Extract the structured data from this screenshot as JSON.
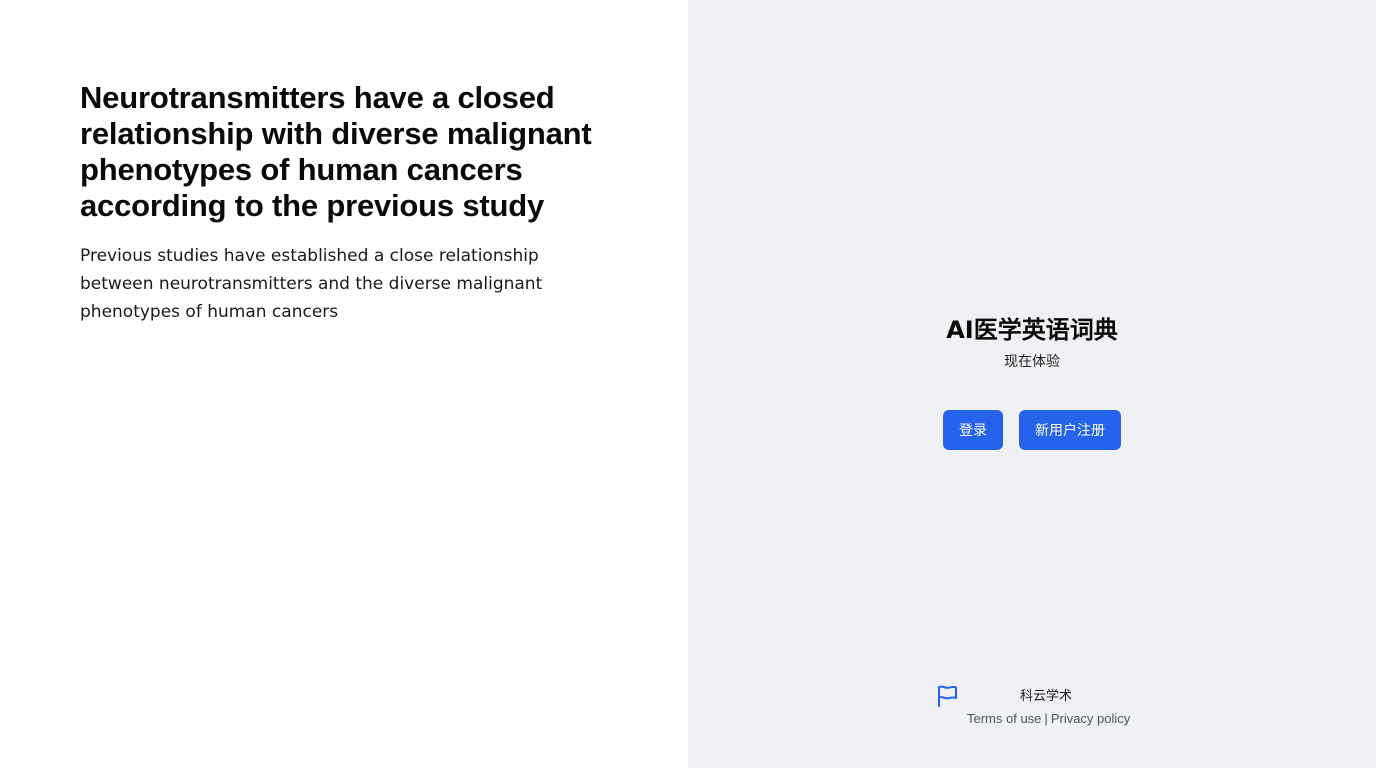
{
  "article": {
    "title": "Neurotransmitters have a closed relationship with diverse malignant phenotypes of human cancers according to the previous study",
    "body": "Previous studies have established a close relationship between neurotransmitters and the diverse malignant phenotypes of human cancers"
  },
  "cta": {
    "title": "AI医学英语词典",
    "subtitle": "现在体验",
    "login_label": "登录",
    "register_label": "新用户注册"
  },
  "footer": {
    "brand": "科云学术",
    "terms_label": "Terms of use",
    "separator": "|",
    "privacy_label": "Privacy policy",
    "icon": "flag-icon"
  },
  "colors": {
    "accent": "#2563eb",
    "right_pane_bg": "#f0f1f4",
    "left_pane_bg": "#ffffff"
  }
}
